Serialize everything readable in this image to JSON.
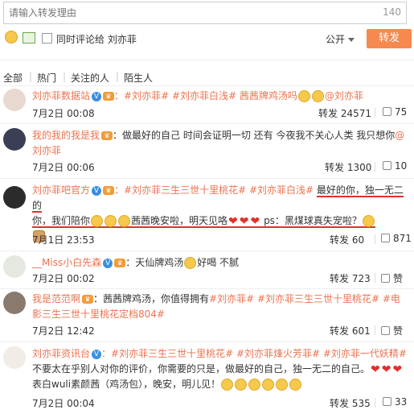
{
  "compose": {
    "placeholder": "请输入转发理由",
    "count": "140"
  },
  "toolbar": {
    "checkbox_label": "同时评论给 刘亦菲",
    "visibility": "公开",
    "send_label": "转发"
  },
  "filters": [
    "全部",
    "热门",
    "关注的人",
    "陌生人"
  ],
  "colors": {
    "accent": "#eb7350",
    "button": "#f5894f",
    "underline": "#e0312b"
  },
  "items": [
    {
      "name": "刘亦菲数据站",
      "lines": [
        "：#刘亦菲# #刘亦菲白浅# 茜茜牌鸡汤吗",
        "@刘亦菲"
      ],
      "time": "7月2日 00:08",
      "repost": "转发 24571",
      "likes": "75"
    },
    {
      "name": "我的我的我是我",
      "text": "：做最好的自己 时间会证明一切 还有 今夜我不关心人类 我只想你",
      "mention": "@刘亦菲",
      "time": "7月2日 00:06",
      "repost": "转发 1300",
      "likes": "10"
    },
    {
      "name": "刘亦菲吧官方",
      "tags": "：#刘亦菲三生三世十里桃花# #刘亦菲白浅#",
      "u1": "最好的你，独一无二的",
      "u2": "你，我们陪你",
      "u3": "茜茜晚安啦，明天见咯",
      "u4": "ps：黑煤球真失宠啦？",
      "time": "7月1日 23:53",
      "repost": "转发 60",
      "likes": "871"
    },
    {
      "name": "__Miss小白先森",
      "text": "：天仙牌鸡汤",
      "text2": "好喝 不腻",
      "time": "7月2日 00:02",
      "repost": "转发 723",
      "likes": "赞"
    },
    {
      "name": "我是范范啊",
      "text": "：茜茜牌鸡汤，你值得拥有",
      "tags": "#刘亦菲# #刘亦菲三生三世十里桃花# #电影三生三世十里桃花定档804#",
      "time": "7月2日 12:42",
      "repost": "转发 601",
      "likes": "赞"
    },
    {
      "name": "刘亦菲资讯台",
      "tags": "：#刘亦菲三生三世十里桃花# #刘亦菲烽火芳菲# #刘亦菲一代妖精#",
      "text": "不要太在乎别人对你的评价，你需要的只是，做最好的自己，独一无二的自己。",
      "text2": "表白wuli素颜茜（鸡汤包），晚安，明儿见！",
      "time": "7月2日 00:04",
      "repost": "转发 535",
      "likes": "33"
    }
  ]
}
